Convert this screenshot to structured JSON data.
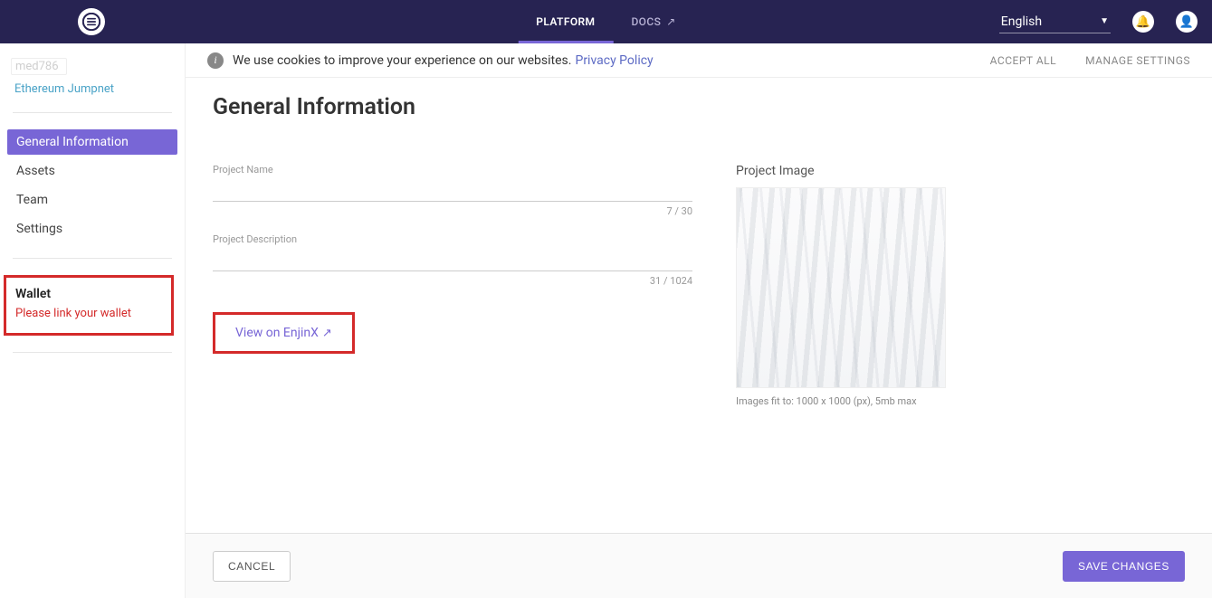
{
  "header": {
    "nav": {
      "platform": "PLATFORM",
      "docs": "DOCS"
    },
    "language": "English"
  },
  "cookie": {
    "text": "We use cookies to improve your experience on our websites.",
    "privacy": "Privacy Policy",
    "accept": "ACCEPT ALL",
    "manage": "MANAGE SETTINGS"
  },
  "sidebar": {
    "project": "med786",
    "network": "Ethereum Jumpnet",
    "items": {
      "general": "General Information",
      "assets": "Assets",
      "team": "Team",
      "settings": "Settings"
    },
    "wallet": {
      "title": "Wallet",
      "warn": "Please link your wallet"
    }
  },
  "page": {
    "title": "General Information",
    "name_label": "Project Name",
    "name_value": "",
    "name_counter": "7 / 30",
    "desc_label": "Project Description",
    "desc_value": "",
    "desc_counter": "31 / 1024",
    "enjinx": "View on EnjinX",
    "image_label": "Project Image",
    "image_hint": "Images fit to: 1000 x 1000 (px), 5mb max"
  },
  "footer": {
    "cancel": "CANCEL",
    "save": "SAVE CHANGES"
  }
}
